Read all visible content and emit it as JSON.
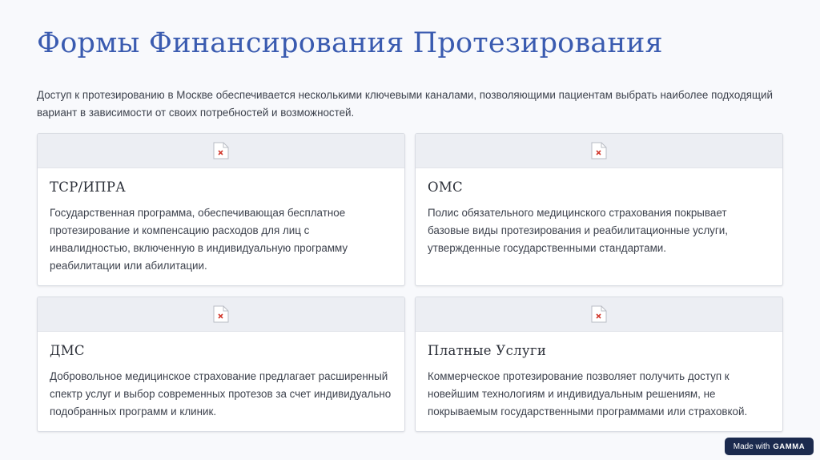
{
  "page": {
    "title": "Формы Финансирования Протезирования",
    "intro": "Доступ к протезированию в Москве обеспечивается несколькими ключевыми каналами, позволяющими пациентам выбрать наиболее подходящий вариант в зависимости от своих потребностей и возможностей."
  },
  "cards": [
    {
      "icon": "broken-image-icon",
      "title": "ТСР/ИПРА",
      "text": "Государственная программа, обеспечивающая бесплатное протезирование и компенсацию расходов для лиц с инвалидностью, включенную в индивидуальную программу реабилитации или абилитации."
    },
    {
      "icon": "broken-image-icon",
      "title": "ОМС",
      "text": "Полис обязательного медицинского страхования покрывает базовые виды протезирования и реабилитационные услуги, утвержденные государственными стандартами."
    },
    {
      "icon": "broken-image-icon",
      "title": "ДМС",
      "text": "Добровольное медицинское страхование предлагает расширенный спектр услуг и выбор современных протезов за счет индивидуально подобранных программ и клиник."
    },
    {
      "icon": "broken-image-icon",
      "title": "Платные Услуги",
      "text": "Коммерческое протезирование позволяет получить доступ к новейшим технологиям и индивидуальным решениям, не покрываемым государственными программами или страховкой."
    }
  ],
  "badge": {
    "prefix": "Made with",
    "brand": "GAMMA"
  },
  "colors": {
    "title": "#3a5bb0",
    "background": "#f8f9fc",
    "card_media": "#eceef3",
    "badge": "#1b2a4e"
  }
}
